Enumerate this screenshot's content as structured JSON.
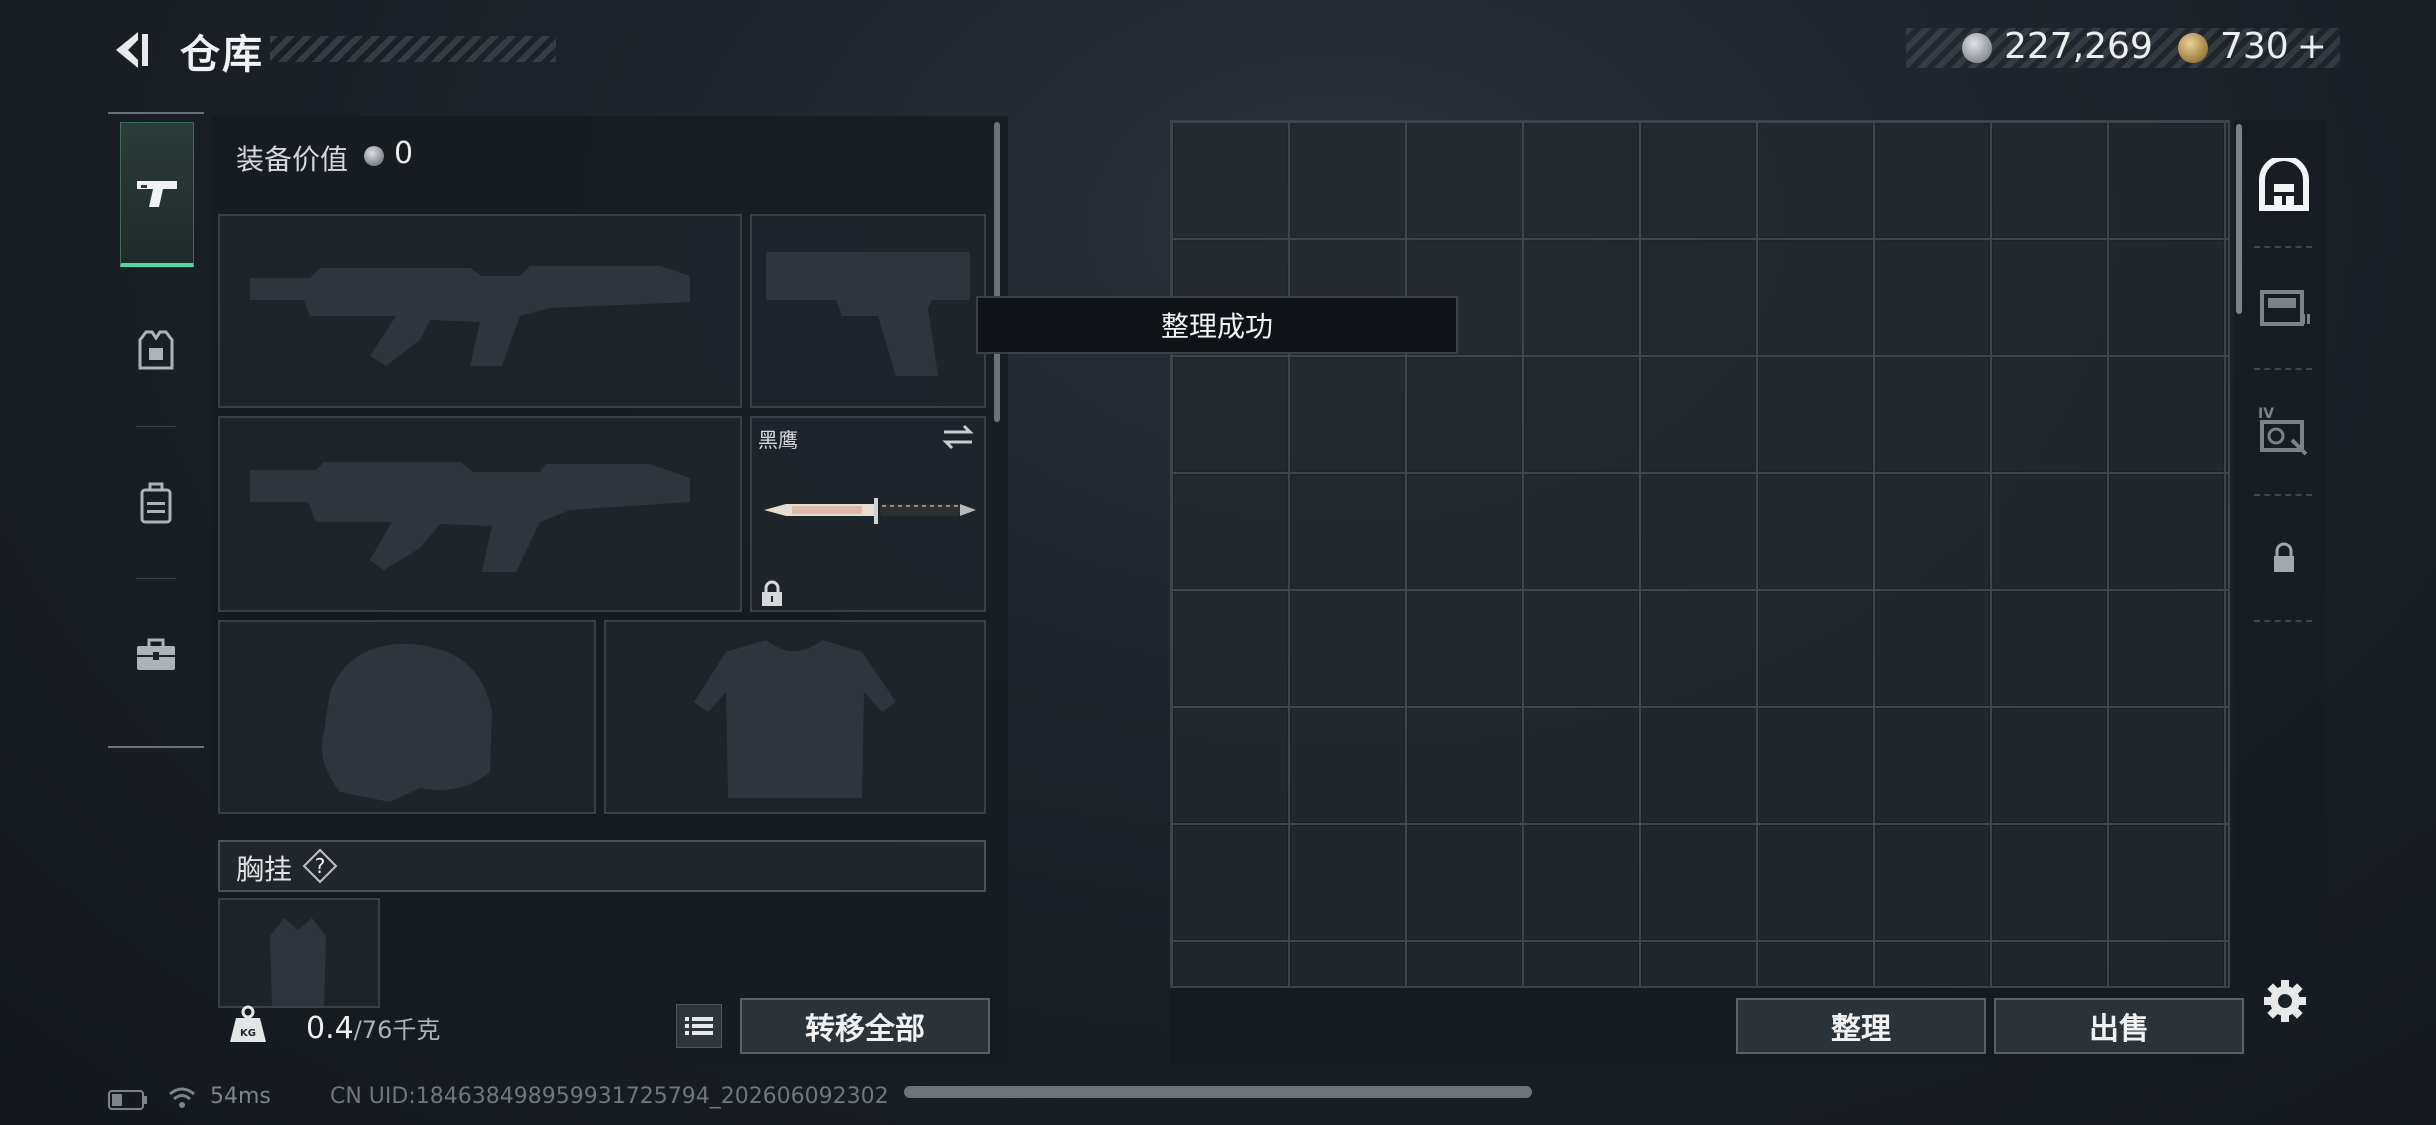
{
  "header": {
    "title": "仓库",
    "back_icon": "back-arrow-icon"
  },
  "currency": {
    "silver_value": "227,269",
    "silver_icon": "silver-coin-icon",
    "gold_value": "730",
    "gold_plus": "+",
    "gold_icon": "gold-coin-icon"
  },
  "tabs": [
    {
      "icon": "pistol-icon",
      "active": true
    },
    {
      "icon": "armor-vest-icon",
      "active": false
    },
    {
      "icon": "backpack-icon",
      "active": false
    },
    {
      "icon": "toolbox-icon",
      "active": false
    }
  ],
  "equipment": {
    "value_label": "装备价值",
    "value": "0",
    "slots": {
      "primary_weapon_1": "rifle-silhouette",
      "secondary_pistol": "pistol-silhouette",
      "primary_weapon_2": "rifle-silhouette",
      "melee": {
        "name": "黑鹰",
        "locked": true
      },
      "helmet": "helmet-silhouette",
      "armor": "armor-silhouette"
    },
    "chest_rig_label": "胸挂",
    "chest_rig_help": "?"
  },
  "weight": {
    "value": "0.4",
    "capacity": "/76千克",
    "icon_text": "KG"
  },
  "buttons": {
    "transfer_all": "转移全部",
    "sort": "整理",
    "sell": "出售"
  },
  "toast": "整理成功",
  "right_rail": {
    "icons": [
      "stash-icon",
      "container-icon",
      "container-iv-icon",
      "lock-icon"
    ],
    "settings_icon": "gear-icon"
  },
  "status": {
    "ping": "54ms",
    "uid": "CN UID:184638498959931725794_202606092302"
  },
  "colors": {
    "accent": "#4fd7a6",
    "panel": "#161b20",
    "border": "#3a4047"
  }
}
